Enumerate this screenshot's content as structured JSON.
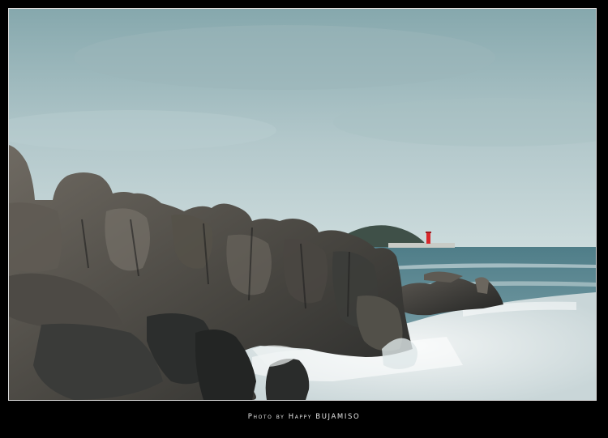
{
  "photo": {
    "subject": "rocky coastline with crashing waves and a red lighthouse on a distant jetty",
    "colors": {
      "sky_top": "#8fb0b4",
      "sky_bottom": "#c5d6d8",
      "sea": "#5f8a93",
      "foam": "#e9eeee",
      "rock_dark": "#2b2d2c",
      "rock_light": "#6e6a62",
      "lighthouse": "#d8262a",
      "frame": "#000000",
      "border": "#d9d9d9"
    }
  },
  "caption": {
    "credit": "Photo by Happy BUJAMISO"
  }
}
